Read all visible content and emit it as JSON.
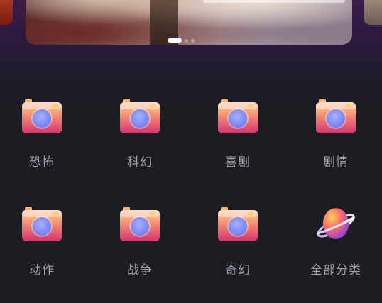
{
  "carousel": {
    "slides": [
      "main",
      "left",
      "right"
    ],
    "active_index": 0,
    "dot_count": 3
  },
  "categories": {
    "row1": [
      {
        "label": "恐怖",
        "icon": "camera-icon"
      },
      {
        "label": "科幻",
        "icon": "camera-icon"
      },
      {
        "label": "喜剧",
        "icon": "camera-icon"
      },
      {
        "label": "剧情",
        "icon": "camera-icon"
      }
    ],
    "row2": [
      {
        "label": "动作",
        "icon": "camera-icon"
      },
      {
        "label": "战争",
        "icon": "camera-icon"
      },
      {
        "label": "奇幻",
        "icon": "camera-icon"
      },
      {
        "label": "全部分类",
        "icon": "planet-icon"
      }
    ]
  },
  "colors": {
    "background": "#1b1d22",
    "label": "#9c9fa6",
    "camera_body_top": "#ffb07a",
    "camera_body_bottom": "#d6316f",
    "lens": "#6f7dfa"
  }
}
